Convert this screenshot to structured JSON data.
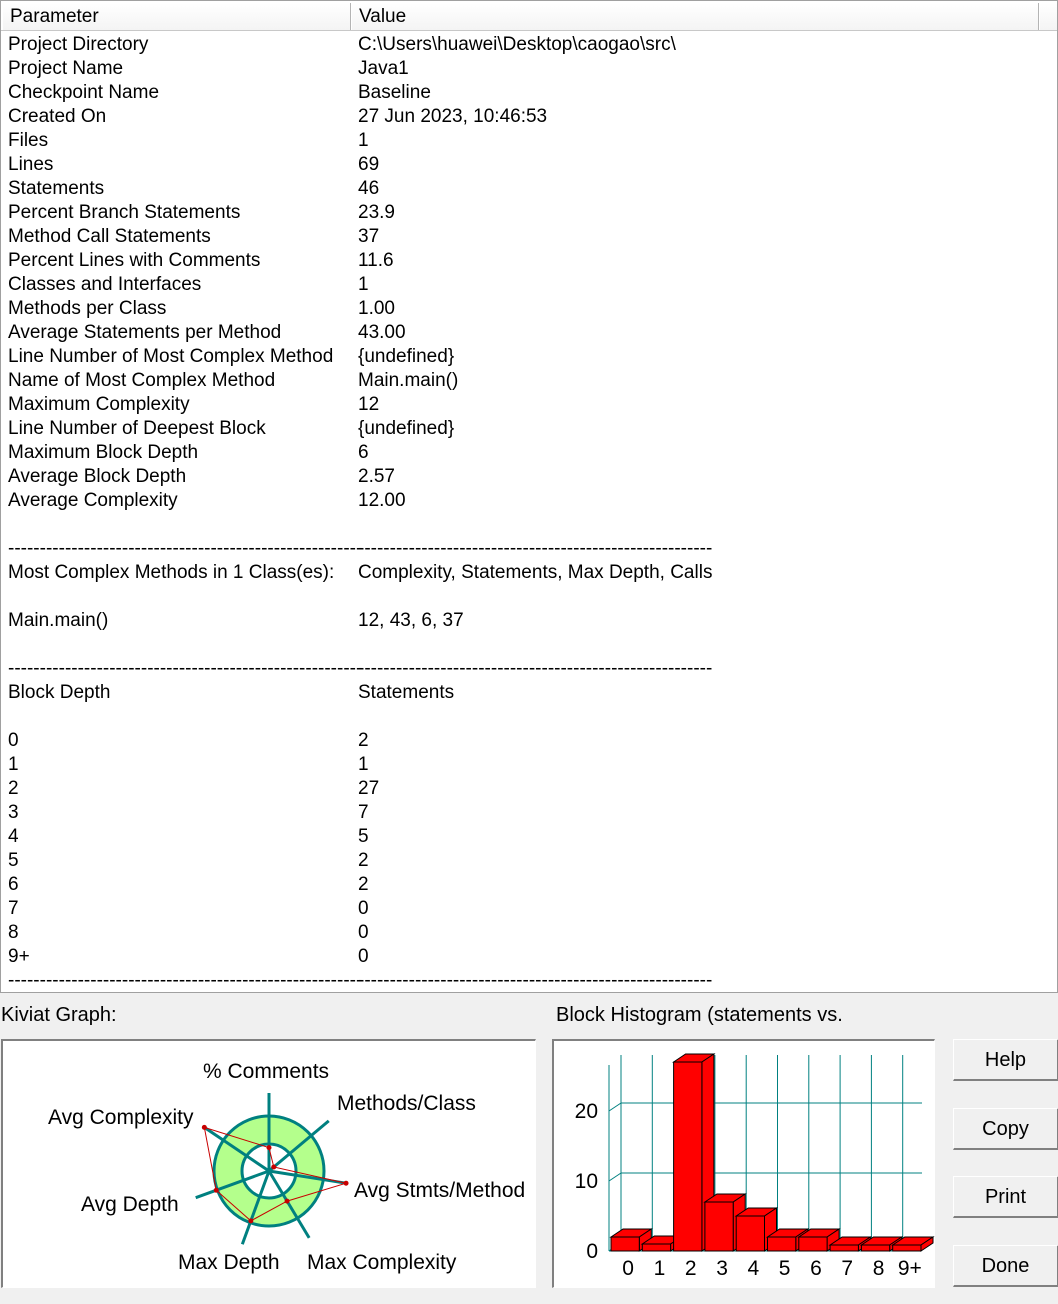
{
  "header": {
    "param_label": "Parameter",
    "value_label": "Value"
  },
  "rows": [
    {
      "p": "Project Directory",
      "v": "C:\\Users\\huawei\\Desktop\\caogao\\src\\"
    },
    {
      "p": "Project Name",
      "v": "Java1"
    },
    {
      "p": "Checkpoint Name",
      "v": "Baseline"
    },
    {
      "p": "Created On",
      "v": "27 Jun 2023, 10:46:53"
    },
    {
      "p": "Files",
      "v": "1"
    },
    {
      "p": "Lines",
      "v": "69"
    },
    {
      "p": "Statements",
      "v": "46"
    },
    {
      "p": "Percent Branch Statements",
      "v": "23.9"
    },
    {
      "p": "Method Call Statements",
      "v": "37"
    },
    {
      "p": "Percent Lines with Comments",
      "v": "11.6"
    },
    {
      "p": "Classes and Interfaces",
      "v": "1"
    },
    {
      "p": "Methods per Class",
      "v": "1.00"
    },
    {
      "p": "Average Statements per Method",
      "v": "43.00"
    },
    {
      "p": "Line Number of Most Complex Method",
      "v": "{undefined}"
    },
    {
      "p": "Name of Most Complex Method",
      "v": "Main.main()"
    },
    {
      "p": "Maximum Complexity",
      "v": "12"
    },
    {
      "p": "Line Number of Deepest Block",
      "v": "{undefined}"
    },
    {
      "p": "Maximum Block Depth",
      "v": "6"
    },
    {
      "p": "Average Block Depth",
      "v": "2.57"
    },
    {
      "p": "Average Complexity",
      "v": "12.00"
    },
    {
      "p": "",
      "v": ""
    },
    {
      "p": "--------------------------------------------------------",
      "v": "--------------------------------------------------------"
    },
    {
      "p": "Most Complex Methods in 1 Class(es):",
      "v": "Complexity, Statements, Max Depth, Calls"
    },
    {
      "p": "",
      "v": ""
    },
    {
      "p": "Main.main()",
      "v": "12, 43, 6, 37"
    },
    {
      "p": "",
      "v": ""
    },
    {
      "p": "--------------------------------------------------------",
      "v": "--------------------------------------------------------"
    },
    {
      "p": "Block Depth",
      "v": "Statements"
    },
    {
      "p": "",
      "v": ""
    },
    {
      "p": "0",
      "v": "2"
    },
    {
      "p": "1",
      "v": "1"
    },
    {
      "p": "2",
      "v": "27"
    },
    {
      "p": "3",
      "v": "7"
    },
    {
      "p": "4",
      "v": "5"
    },
    {
      "p": "5",
      "v": "2"
    },
    {
      "p": "6",
      "v": "2"
    },
    {
      "p": "7",
      "v": "0"
    },
    {
      "p": "8",
      "v": "0"
    },
    {
      "p": "9+",
      "v": "0"
    },
    {
      "p": "--------------------------------------------------------",
      "v": "--------------------------------------------------------"
    }
  ],
  "kiviat": {
    "label": "Kiviat Graph:",
    "axes": [
      "% Comments",
      "Methods/Class",
      "Avg Stmts/Method",
      "Max Complexity",
      "Max Depth",
      "Avg Depth",
      "Avg Complexity"
    ],
    "ring_fill_color": "#b4ff8c",
    "ring_stroke_color": "#008080",
    "data_color": "#c80000"
  },
  "chart_data": {
    "type": "bar",
    "title": "Block Histogram (statements vs.",
    "categories": [
      "0",
      "1",
      "2",
      "3",
      "4",
      "5",
      "6",
      "7",
      "8",
      "9+"
    ],
    "values": [
      2,
      1,
      27,
      7,
      5,
      2,
      2,
      0,
      0,
      0
    ],
    "ylim": [
      0,
      28
    ],
    "yticks": [
      0,
      10,
      20
    ],
    "grid": true,
    "bar_color": "#ff0000",
    "grid_color": "#008080"
  },
  "buttons": {
    "help": "Help",
    "copy": "Copy",
    "print": "Print",
    "done": "Done"
  }
}
